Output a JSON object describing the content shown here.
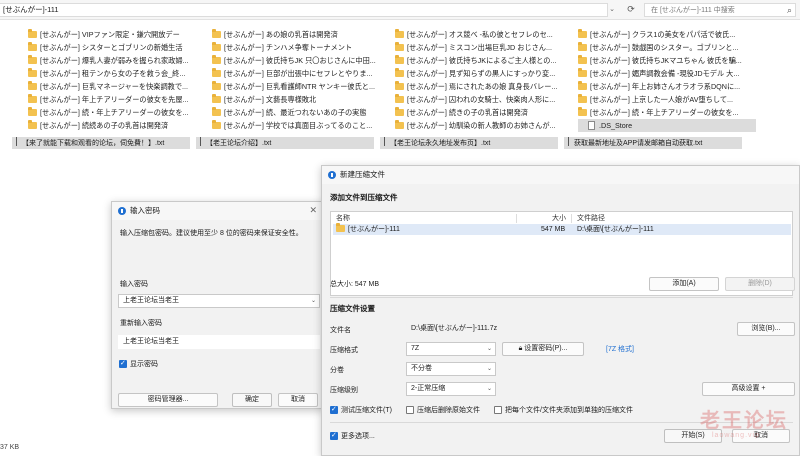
{
  "explorer": {
    "path": "[せぶんがー]-111",
    "search_placeholder": "在 [せぶんがー]-111 中搜索",
    "status_size": "37 KB",
    "folders": [
      [
        "[せぶんがー] VIPファン限定・鎌穴開放デー",
        "[せぶんがー] あの娘の乳首は開発済",
        "[せぶんがー] オス競べ -私の彼とセフレのセ...",
        "[せぶんがー] クラス1の美女をパパ活で彼氏..."
      ],
      [
        "[せぶんがー] シスターとゴブリンの新婚生活",
        "[せぶんがー] チンハメ争奪トーナメント",
        "[せぶんがー] ミスコン出場巨乳JD おじさん...",
        "[せぶんがー] 鼓戯国のシスター。ゴブリンと..."
      ],
      [
        "[せぶんがー] 爆乳人妻が弱みを握られ家政婦...",
        "[せぶんがー] 彼氏持ちJK 只〇おじさんに中田...",
        "[せぶんがー] 彼氏持ちJKによるご主人様との...",
        "[せぶんがー] 彼氏持ちJKマユちゃん 彼氏を騙..."
      ],
      [
        "[せぶんがー] 租テンから女の子を救う会_終...",
        "[せぶんがー] 巨部が出張中にセフレとやりま...",
        "[せぶんがー] 見ず知らずの黒人にすっかり変...",
        "[せぶんがー] 媚声調教会備 -現役JDモデル 大..."
      ],
      [
        "[せぶんがー] 巨乳マネージャーを快楽調教で...",
        "[せぶんがー] 巨乳看護師NTR ヤンキー彼氏と...",
        "[せぶんがー] 焉にされたあの娘 真身長バレー...",
        "[せぶんがー] 年上お姉さんオラオラ系DQNに..."
      ],
      [
        "[せぶんがー] 年上チアリーダーの彼女を先屋...",
        "[せぶんがー] 文藝長専様敗北",
        "[せぶんがー] 囚われの女騎士、快楽肉人形に...",
        "[せぶんがー] 上京した一人娘がAV堕ちして..."
      ],
      [
        "[せぶんがー] 続・年上チアリーダーの彼女を...",
        "[せぶんがー] 続、最近つれないあの子の実態",
        "[せぶんがー] 続きの子の乳首は開発済",
        "[せぶんがー] 続・年上チアリーダーの彼女を..."
      ],
      [
        "[せぶんがー] 続続あの子の乳首は開発済",
        "[せぶんがー] 学校では真面目ぶってるのこと...",
        "[せぶんがー] 幼馴染の新人教師のお姉さんが...",
        ".DS_Store"
      ]
    ],
    "txt_files": [
      "【来了就能下载和观看的论坛，伺免費！】.txt",
      "【老王论坛介绍】.txt",
      "【老王论坛永久地址发布页】.txt",
      "获取最新地址及APP请发邮箱自动获取.txt"
    ]
  },
  "pwd_dialog": {
    "title": "输入密码",
    "desc": "输入压缩包密码。建议使用至少 8 位的密码来保证安全性。",
    "pwd_label": "输入密码",
    "pwd_value": "上老王论坛当老王",
    "repwd_label": "重新输入密码",
    "repwd_value": "上老王论坛当老王",
    "show_pwd": "显示密码",
    "btn_manager": "密码管理器...",
    "btn_ok": "确定",
    "btn_cancel": "取消"
  },
  "cmp_dialog": {
    "title": "新建压缩文件",
    "sec_add": "添加文件到压缩文件",
    "col_name": "名称",
    "col_size": "大小",
    "col_path": "文件路径",
    "row_name": "[せぶんがー]-111",
    "row_size": "547 MB",
    "row_path": "D:\\桌面\\[せぶんがー]-111",
    "total": "总大小: 547 MB",
    "btn_add": "添加(A)",
    "btn_remove": "删除(D)",
    "sec_settings": "压缩文件设置",
    "lbl_file": "文件名",
    "file_value": "D:\\桌面\\[せぶんがー]-111.7z",
    "btn_browse": "浏览(B)...",
    "lbl_format": "压缩格式",
    "format_value": "7Z",
    "btn_setpwd": "设置密码(P)...",
    "format_tag": "[7Z 格式]",
    "lbl_split": "分卷",
    "split_value": "不分卷",
    "lbl_level": "压缩级别",
    "level_value": "2-正常压缩",
    "btn_advanced": "高级设置 +",
    "chk_test": "测试压缩文件(T)",
    "chk_delete": "压缩后删除原始文件",
    "chk_each": "把每个文件/文件夹添加到单独的压缩文件",
    "chk_more": "更多选项...",
    "btn_start": "开始(S)",
    "btn_cancel": "取消"
  },
  "watermark": {
    "main": "老王论坛",
    "sub": "laowang.vip"
  }
}
